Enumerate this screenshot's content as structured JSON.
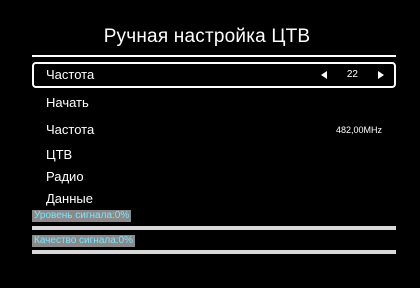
{
  "title": "Ручная настройка ЦТВ",
  "menu": {
    "items": [
      {
        "label": "Частота",
        "value": "22",
        "selected": true
      },
      {
        "label": "Начать"
      },
      {
        "label": "Частота",
        "value": "482,00MHz"
      },
      {
        "label": "ЦТВ"
      },
      {
        "label": "Радио"
      },
      {
        "label": "Данные"
      }
    ]
  },
  "signal": {
    "level_label": "Уровень сигнала:0%",
    "level_fraction": 0.0,
    "quality_label": "Качество сигнала:0%",
    "quality_fraction": 0.0
  },
  "colors": {
    "background": "#000000",
    "text": "#ffffff",
    "label_text": "#7fe4ff",
    "label_bg": "#8a8a8a",
    "bar_bg": "#d8d8d8",
    "bar_fill": "#2fa0ff"
  },
  "icons": {
    "left_arrow": "triangle-left-icon",
    "right_arrow": "triangle-right-icon"
  }
}
